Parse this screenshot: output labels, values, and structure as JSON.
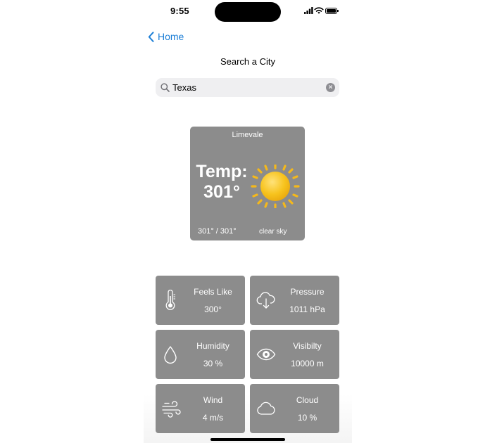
{
  "status_bar": {
    "time": "9:55",
    "icons": [
      "cellular-signal-icon",
      "wifi-icon",
      "battery-icon"
    ]
  },
  "nav": {
    "back_label": "Home",
    "back_icon": "chevron-left-icon",
    "title": "Search a City"
  },
  "search": {
    "value": "Texas",
    "icon": "magnifying-glass-icon",
    "clear_icon": "clear-circle-icon"
  },
  "current": {
    "city": "Limevale",
    "temp_label": "Temp:",
    "temp_value": "301°",
    "minmax": "301° / 301°",
    "description": "clear sky",
    "icon": "sun-icon"
  },
  "details": {
    "feels_like": {
      "label": "Feels Like",
      "value": "300°",
      "icon": "thermometer-icon"
    },
    "pressure": {
      "label": "Pressure",
      "value": "1011 hPa",
      "icon": "cloud-download-icon"
    },
    "humidity": {
      "label": "Humidity",
      "value": "30 %",
      "icon": "water-drop-icon"
    },
    "visibility": {
      "label": "Visibilty",
      "value": "10000 m",
      "icon": "eye-icon"
    },
    "wind": {
      "label": "Wind",
      "value": "4 m/s",
      "icon": "wind-icon"
    },
    "cloud": {
      "label": "Cloud",
      "value": "10 %",
      "icon": "cloud-icon"
    }
  },
  "colors": {
    "accent": "#1c7ed6",
    "card_background": "#8c8c8c",
    "search_background": "#efeff1",
    "sun": "#f5c21b"
  }
}
